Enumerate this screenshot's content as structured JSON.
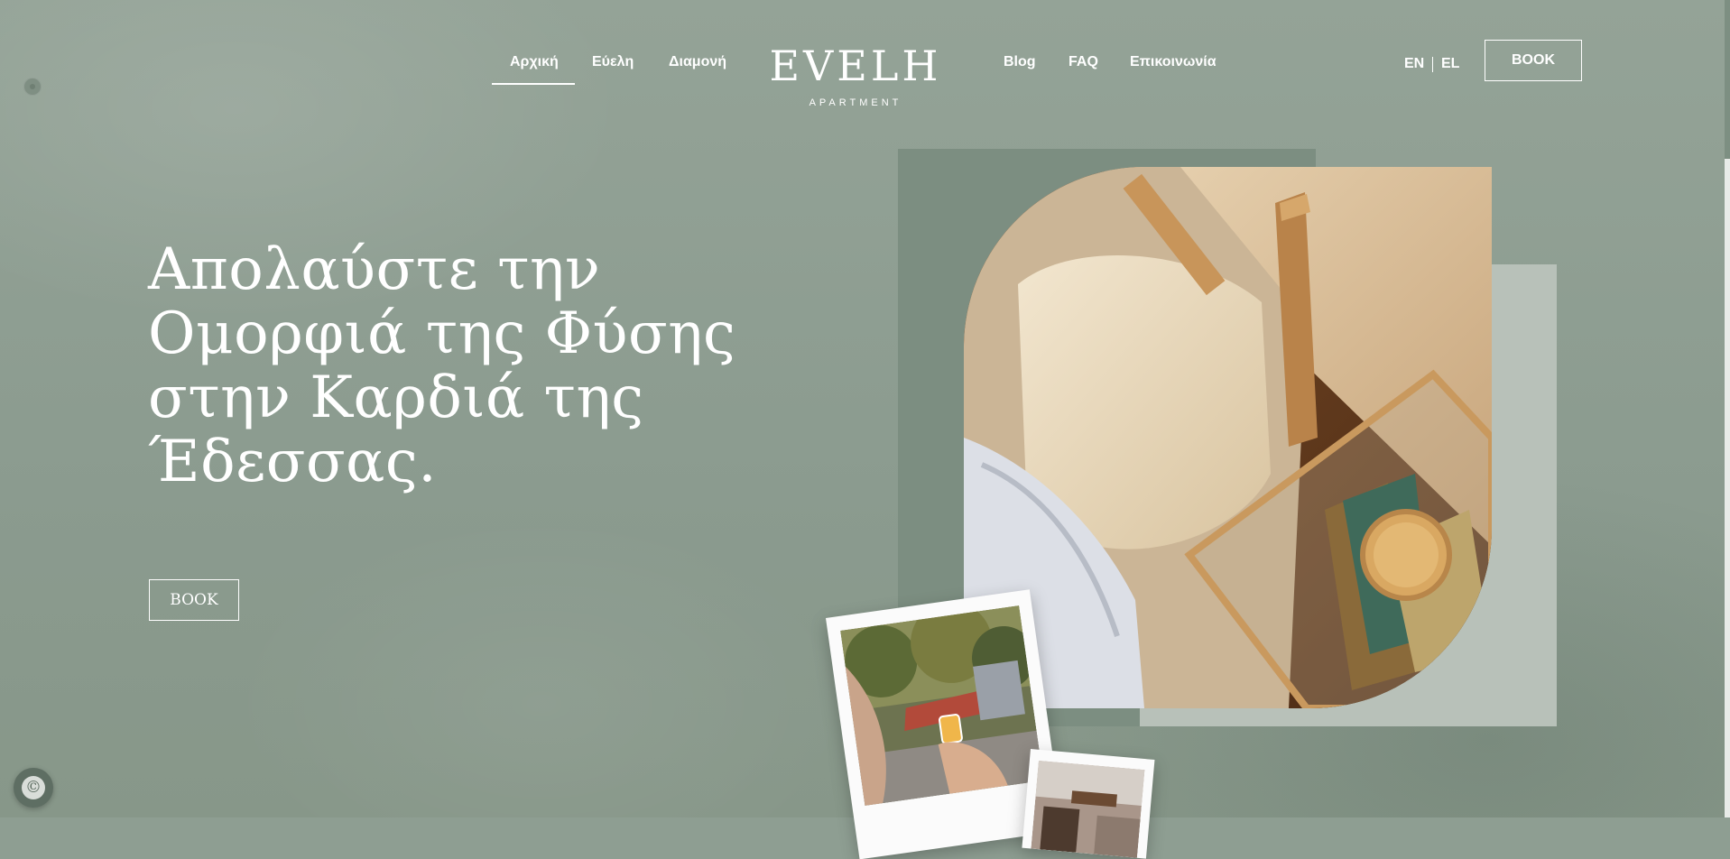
{
  "nav": {
    "left_items": [
      "Αρχική",
      "Εύελη",
      "Διαμονή"
    ],
    "right_items": [
      "Blog",
      "FAQ",
      "Επικοινωνία"
    ],
    "active": "Αρχική"
  },
  "logo": {
    "word": "EVELH",
    "sub": "APARTMENT"
  },
  "lang": {
    "en": "EN",
    "el": "EL"
  },
  "header": {
    "book_label": "BOOK"
  },
  "hero": {
    "title_lines": [
      "Απολαύστε την",
      "Ομορφιά της Φύσης",
      "στην Καρδιά της",
      "Έδεσσας."
    ],
    "book_label": "BOOK"
  },
  "colors": {
    "background": "#8e9e92",
    "panel_dark": "#7c8e81",
    "panel_light": "#b8c1b9",
    "text": "#ffffff"
  },
  "icons": {
    "cookie_badge": "cookie-consent-icon",
    "dot": "slider-dot-icon"
  }
}
